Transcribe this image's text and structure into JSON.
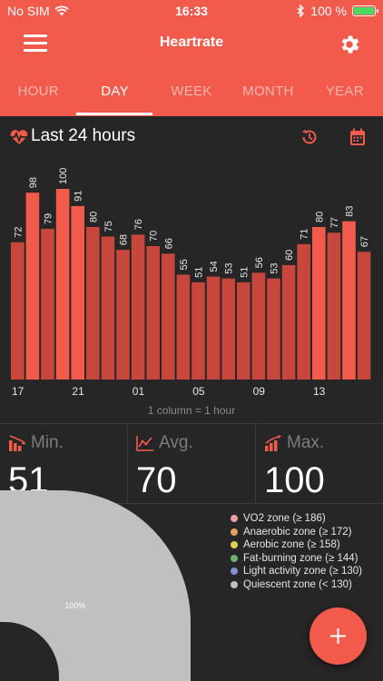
{
  "status_bar": {
    "carrier": "No SIM",
    "time": "16:33",
    "battery": "100 %"
  },
  "header": {
    "title": "Heartrate"
  },
  "tabs": [
    {
      "label": "HOUR",
      "active": false
    },
    {
      "label": "DAY",
      "active": true
    },
    {
      "label": "WEEK",
      "active": false
    },
    {
      "label": "MONTH",
      "active": false
    },
    {
      "label": "YEAR",
      "active": false
    }
  ],
  "chart_section": {
    "title": "Last 24 hours",
    "footnote": "1 column = 1 hour"
  },
  "chart_data": {
    "type": "bar",
    "values": [
      72,
      98,
      79,
      100,
      91,
      80,
      75,
      68,
      76,
      70,
      66,
      55,
      51,
      54,
      53,
      51,
      56,
      53,
      60,
      71,
      80,
      77,
      83,
      67
    ],
    "highlighted": [
      false,
      true,
      false,
      true,
      true,
      false,
      false,
      false,
      false,
      false,
      false,
      false,
      false,
      false,
      false,
      false,
      false,
      false,
      false,
      false,
      true,
      false,
      true,
      false
    ],
    "x_tick_labels": [
      {
        "index": 0,
        "label": "17"
      },
      {
        "index": 4,
        "label": "21"
      },
      {
        "index": 8,
        "label": "01"
      },
      {
        "index": 12,
        "label": "05"
      },
      {
        "index": 16,
        "label": "09"
      },
      {
        "index": 20,
        "label": "13"
      }
    ],
    "colors": {
      "bar": "#c8473c",
      "highlight": "#f25b4c",
      "label": "#e8e8e8",
      "tick": "#e8e8e8"
    }
  },
  "stats": [
    {
      "label": "Min.",
      "value": "51",
      "icon": "bar-chart-down-icon"
    },
    {
      "label": "Avg.",
      "value": "70",
      "icon": "line-chart-icon"
    },
    {
      "label": "Max.",
      "value": "100",
      "icon": "bar-chart-up-icon"
    }
  ],
  "zones": {
    "pie_label": "100%",
    "pie_fraction": 1.0,
    "pie_color": "#c0c0c0",
    "legend": [
      {
        "label": "VO2 zone (≥ 186)",
        "color": "#e8a0a0"
      },
      {
        "label": "Anaerobic zone (≥ 172)",
        "color": "#e8a060"
      },
      {
        "label": "Aerobic zone (≥ 158)",
        "color": "#e0d050"
      },
      {
        "label": "Fat-burning zone (≥ 144)",
        "color": "#70b070"
      },
      {
        "label": "Light activity zone (≥ 130)",
        "color": "#8090d0"
      },
      {
        "label": "Quiescent zone (< 130)",
        "color": "#c0c0c0"
      }
    ]
  },
  "fab": {
    "icon": "plus-icon"
  },
  "colors": {
    "accent": "#f25b4c",
    "background": "#262626"
  }
}
